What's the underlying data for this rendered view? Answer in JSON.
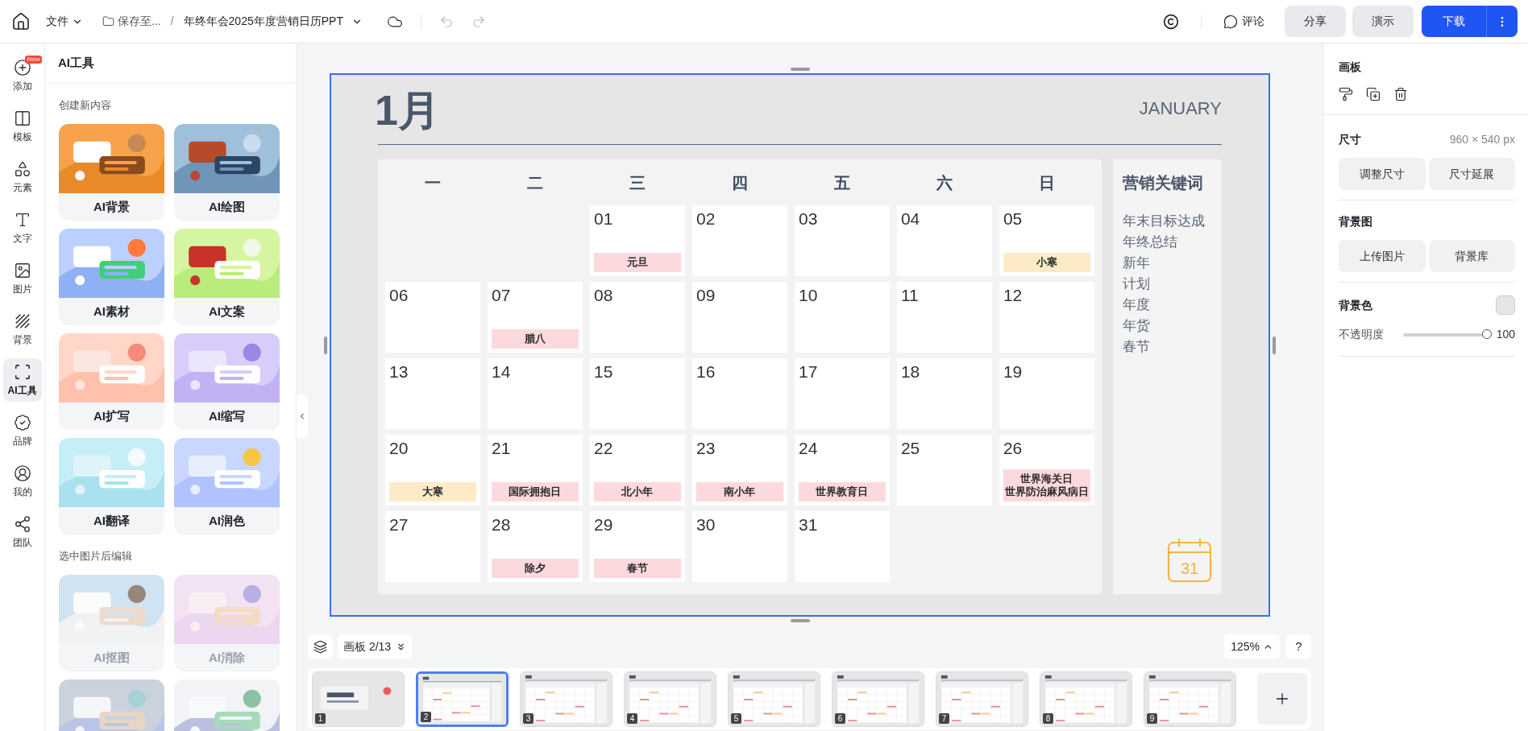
{
  "topbar": {
    "file_menu": "文件",
    "save_location": "保存至...",
    "separator": "/",
    "doc_title": "年终年会2025年度营销日历PPT",
    "comment": "评论",
    "share": "分享",
    "present": "演示",
    "download": "下载"
  },
  "rail": [
    {
      "label": "添加",
      "badge": "New",
      "selected": false
    },
    {
      "label": "模板",
      "selected": false
    },
    {
      "label": "元素",
      "selected": false
    },
    {
      "label": "文字",
      "selected": false
    },
    {
      "label": "图片",
      "selected": false
    },
    {
      "label": "背景",
      "selected": false
    },
    {
      "label": "AI工具",
      "selected": true
    },
    {
      "label": "品牌",
      "selected": false
    },
    {
      "label": "我的",
      "selected": false
    },
    {
      "label": "团队",
      "selected": false
    }
  ],
  "ai_panel": {
    "title": "AI工具",
    "sections": [
      {
        "title": "创建新内容",
        "cards": [
          {
            "label": "AI背景",
            "disabled": false
          },
          {
            "label": "AI绘图",
            "disabled": false
          },
          {
            "label": "AI素材",
            "disabled": false
          },
          {
            "label": "AI文案",
            "disabled": false
          },
          {
            "label": "AI扩写",
            "disabled": false
          },
          {
            "label": "AI缩写",
            "disabled": false
          },
          {
            "label": "AI翻译",
            "disabled": false
          },
          {
            "label": "AI润色",
            "disabled": false
          }
        ]
      },
      {
        "title": "选中图片后编辑",
        "cards": [
          {
            "label": "AI抠图",
            "disabled": true
          },
          {
            "label": "AI消除",
            "disabled": true
          }
        ]
      }
    ]
  },
  "slide": {
    "month": "1月",
    "month_en": "JANUARY",
    "weekdays": [
      "一",
      "二",
      "三",
      "四",
      "五",
      "六",
      "日"
    ],
    "weeks": [
      [
        {
          "kind": "blank"
        },
        {
          "kind": "blank"
        },
        {
          "kind": "day",
          "day": "01",
          "event": {
            "lines": [
              "元旦"
            ],
            "color": "#fcd9dd"
          }
        },
        {
          "kind": "day",
          "day": "02"
        },
        {
          "kind": "day",
          "day": "03"
        },
        {
          "kind": "day",
          "day": "04"
        },
        {
          "kind": "day",
          "day": "05",
          "event": {
            "lines": [
              "小寒"
            ],
            "color": "#fdebc8"
          }
        }
      ],
      [
        {
          "kind": "day",
          "day": "06"
        },
        {
          "kind": "day",
          "day": "07",
          "event": {
            "lines": [
              "腊八"
            ],
            "color": "#fcd9dd"
          }
        },
        {
          "kind": "day",
          "day": "08"
        },
        {
          "kind": "day",
          "day": "09"
        },
        {
          "kind": "day",
          "day": "10"
        },
        {
          "kind": "day",
          "day": "11"
        },
        {
          "kind": "day",
          "day": "12"
        }
      ],
      [
        {
          "kind": "day",
          "day": "13"
        },
        {
          "kind": "day",
          "day": "14"
        },
        {
          "kind": "day",
          "day": "15"
        },
        {
          "kind": "day",
          "day": "16"
        },
        {
          "kind": "day",
          "day": "17"
        },
        {
          "kind": "day",
          "day": "18"
        },
        {
          "kind": "day",
          "day": "19"
        }
      ],
      [
        {
          "kind": "day",
          "day": "20",
          "event": {
            "lines": [
              "大寒"
            ],
            "color": "#fdebc8"
          }
        },
        {
          "kind": "day",
          "day": "21",
          "event": {
            "lines": [
              "国际拥抱日"
            ],
            "color": "#fcd9dd"
          }
        },
        {
          "kind": "day",
          "day": "22",
          "event": {
            "lines": [
              "北小年"
            ],
            "color": "#fcd9dd"
          }
        },
        {
          "kind": "day",
          "day": "23",
          "event": {
            "lines": [
              "南小年"
            ],
            "color": "#fcd9dd"
          }
        },
        {
          "kind": "day",
          "day": "24",
          "event": {
            "lines": [
              "世界教育日"
            ],
            "color": "#fcd9dd"
          }
        },
        {
          "kind": "day",
          "day": "25"
        },
        {
          "kind": "day",
          "day": "26",
          "event": {
            "lines": [
              "世界海关日",
              "世界防治麻风病日"
            ],
            "color": "#fcd9dd"
          }
        }
      ],
      [
        {
          "kind": "day",
          "day": "27"
        },
        {
          "kind": "day",
          "day": "28",
          "event": {
            "lines": [
              "除夕"
            ],
            "color": "#fcd9dd"
          }
        },
        {
          "kind": "day",
          "day": "29",
          "event": {
            "lines": [
              "春节"
            ],
            "color": "#fcd9dd"
          }
        },
        {
          "kind": "day",
          "day": "30"
        },
        {
          "kind": "day",
          "day": "31"
        },
        {
          "kind": "blank"
        },
        {
          "kind": "blank"
        }
      ]
    ],
    "keywords_title": "营销关键词",
    "keywords": [
      "年末目标达成",
      "年终总结",
      "新年",
      "计划",
      "年度",
      "年货",
      "春节"
    ],
    "calendar_icon_day": "31"
  },
  "canvas_bar": {
    "board": "画板 2/13",
    "zoom": "125%",
    "help": "?"
  },
  "thumbnails": [
    {
      "number": "1",
      "kind": "cover",
      "selected": false
    },
    {
      "number": "2",
      "kind": "calendar",
      "selected": true
    },
    {
      "number": "3",
      "kind": "calendar",
      "selected": false
    },
    {
      "number": "4",
      "kind": "calendar",
      "selected": false
    },
    {
      "number": "5",
      "kind": "calendar",
      "selected": false
    },
    {
      "number": "6",
      "kind": "calendar",
      "selected": false
    },
    {
      "number": "7",
      "kind": "calendar",
      "selected": false
    },
    {
      "number": "8",
      "kind": "calendar",
      "selected": false
    },
    {
      "number": "9",
      "kind": "calendar",
      "selected": false
    }
  ],
  "props": {
    "title": "画板",
    "size_label": "尺寸",
    "size_value": "960 × 540 px",
    "size_buttons": [
      "调整尺寸",
      "尺寸延展"
    ],
    "bg_image_label": "背景图",
    "bg_image_buttons": [
      "上传图片",
      "背景库"
    ],
    "bg_color_label": "背景色",
    "opacity_label": "不透明度",
    "opacity": {
      "level": 1.0,
      "reading": "100"
    }
  }
}
